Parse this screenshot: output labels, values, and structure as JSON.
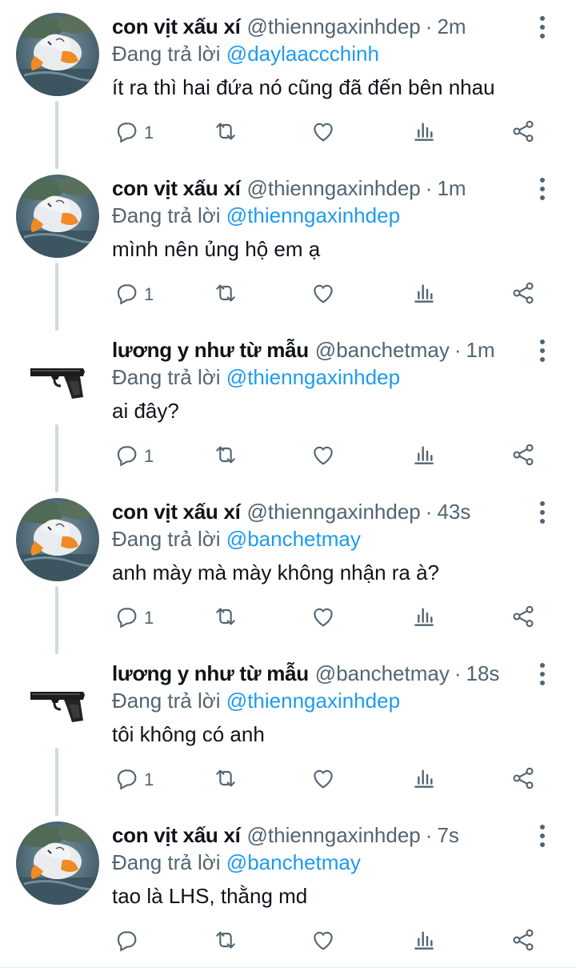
{
  "colors": {
    "accent": "#1d9bf0",
    "secondary": "#536471",
    "text": "#0f1419"
  },
  "tweets": [
    {
      "name": "con vịt xấu xí",
      "handle": "@thienngaxinhdep",
      "separator": "·",
      "time": "2m",
      "reply_prefix": "Đang trả lời",
      "reply_to": "@daylaaccchinh",
      "text": "ít ra thì hai đứa nó cũng đã đến bên nhau",
      "reply_count": "1",
      "avatar": "duck-avatar"
    },
    {
      "name": "con vịt xấu xí",
      "handle": "@thienngaxinhdep",
      "separator": "·",
      "time": "1m",
      "reply_prefix": "Đang trả lời",
      "reply_to": "@thienngaxinhdep",
      "text": "mình nên ủng hộ em ạ",
      "reply_count": "1",
      "avatar": "duck-avatar"
    },
    {
      "name": "lương y như từ mẫu",
      "handle": "@banchetmay",
      "separator": "·",
      "time": "1m",
      "reply_prefix": "Đang trả lời",
      "reply_to": "@thienngaxinhdep",
      "text": "ai đây?",
      "reply_count": "1",
      "avatar": "pistol-avatar"
    },
    {
      "name": "con vịt xấu xí",
      "handle": "@thienngaxinhdep",
      "separator": "·",
      "time": "43s",
      "reply_prefix": "Đang trả lời",
      "reply_to": "@banchetmay",
      "text": "anh mày mà mày không nhận ra à?",
      "reply_count": "1",
      "avatar": "duck-avatar"
    },
    {
      "name": "lương y như từ mẫu",
      "handle": "@banchetmay",
      "separator": "·",
      "time": "18s",
      "reply_prefix": "Đang trả lời",
      "reply_to": "@thienngaxinhdep",
      "text": "tôi không có anh",
      "reply_count": "1",
      "avatar": "pistol-avatar"
    },
    {
      "name": "con vịt xấu xí",
      "handle": "@thienngaxinhdep",
      "separator": "·",
      "time": "7s",
      "reply_prefix": "Đang trả lời",
      "reply_to": "@banchetmay",
      "text": "tao là LHS, thằng md",
      "reply_count": "",
      "avatar": "duck-avatar"
    }
  ]
}
